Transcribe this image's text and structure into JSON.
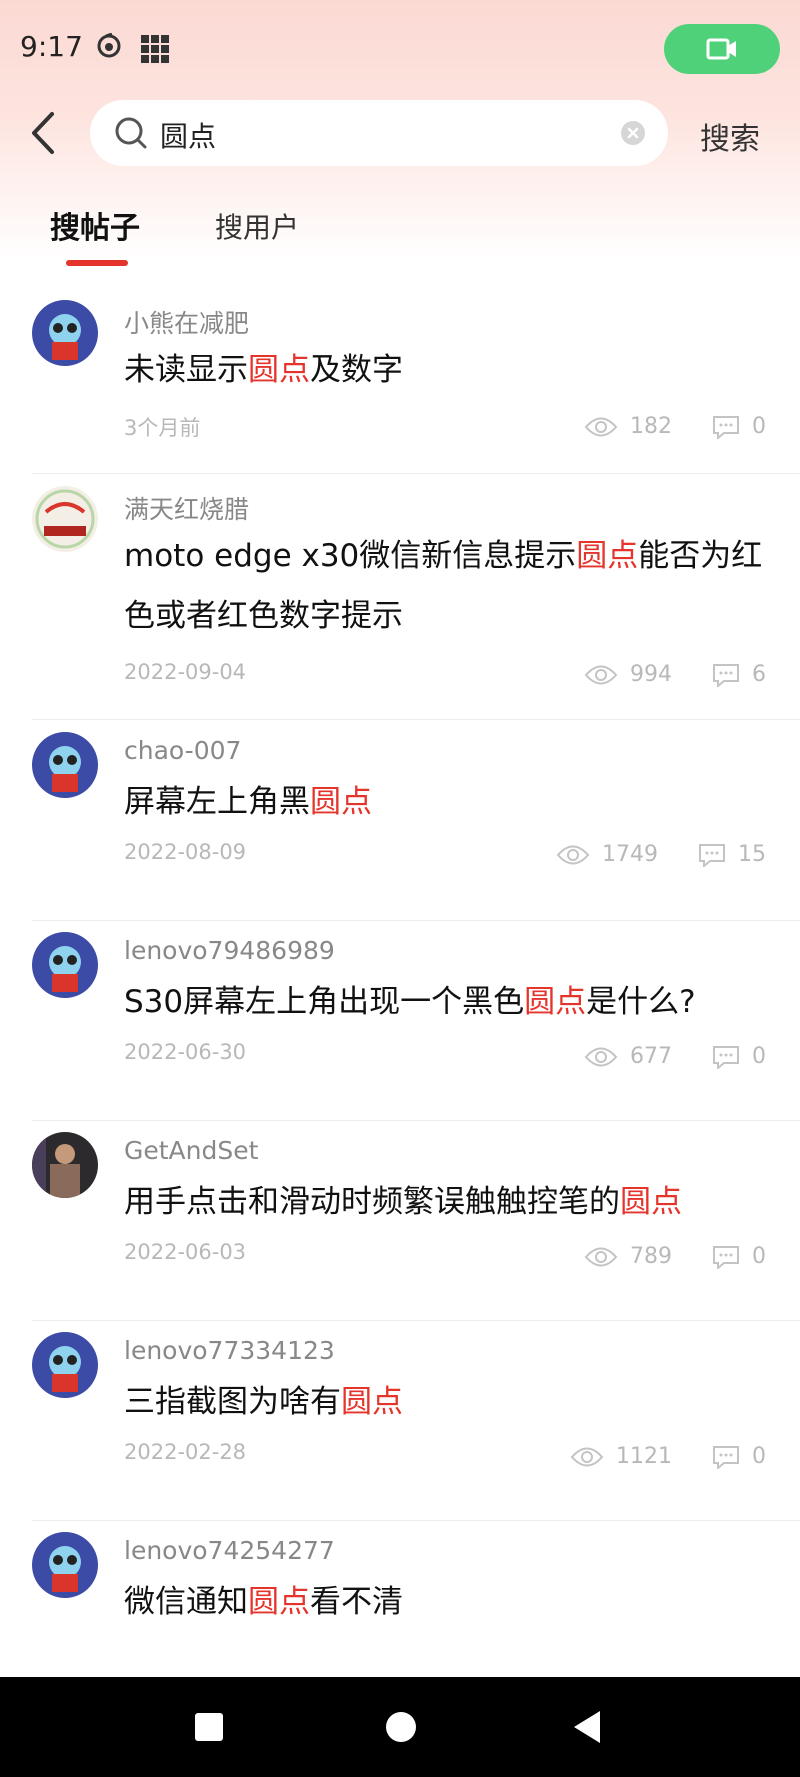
{
  "status_bar": {
    "time": "9:17"
  },
  "search": {
    "query": "圆点",
    "button_label": "搜索"
  },
  "tabs": [
    {
      "label": "搜帖子",
      "active": true
    },
    {
      "label": "搜用户",
      "active": false
    }
  ],
  "posts": [
    {
      "username": "小熊在减肥",
      "title_before": "未读显示",
      "title_highlight": "圆点",
      "title_after": "及数字",
      "date": "3个月前",
      "views": "182",
      "comments": "0"
    },
    {
      "username": "满天红烧腊",
      "title_before": "moto edge x30微信新信息提示",
      "title_highlight": "圆点",
      "title_after": "能否为红色或者红色数字提示",
      "date": "2022-09-04",
      "views": "994",
      "comments": "6"
    },
    {
      "username": "chao-007",
      "title_before": "屏幕左上角黑",
      "title_highlight": "圆点",
      "title_after": "",
      "date": "2022-08-09",
      "views": "1749",
      "comments": "15"
    },
    {
      "username": "lenovo79486989",
      "title_before": "S30屏幕左上角出现一个黑色",
      "title_highlight": "圆点",
      "title_after": "是什么?",
      "date": "2022-06-30",
      "views": "677",
      "comments": "0"
    },
    {
      "username": "GetAndSet",
      "title_before": "用手点击和滑动时频繁误触触控笔的",
      "title_highlight": "圆点",
      "title_after": "",
      "date": "2022-06-03",
      "views": "789",
      "comments": "0"
    },
    {
      "username": "lenovo77334123",
      "title_before": "三指截图为啥有",
      "title_highlight": "圆点",
      "title_after": "",
      "date": "2022-02-28",
      "views": "1121",
      "comments": "0"
    },
    {
      "username": "lenovo74254277",
      "title_before": "微信通知",
      "title_highlight": "圆点",
      "title_after": "看不清",
      "date": "",
      "views": "",
      "comments": ""
    }
  ],
  "colors": {
    "highlight": "#e5342b",
    "video_button": "#4fd17a"
  },
  "icons": [
    "back-icon",
    "search-icon",
    "clear-icon",
    "video-camera-icon",
    "eye-icon",
    "comment-icon"
  ]
}
